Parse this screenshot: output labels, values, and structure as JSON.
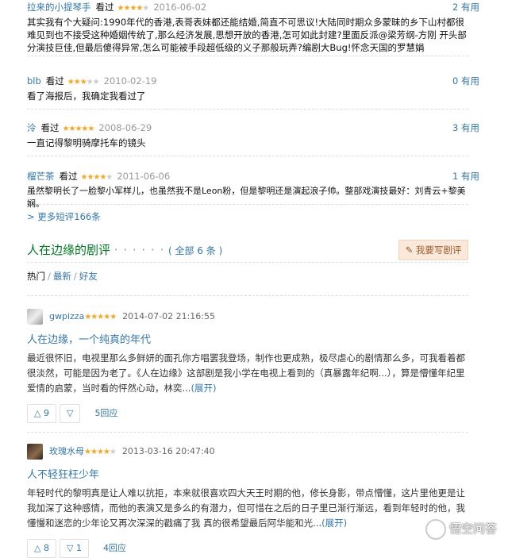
{
  "short_comments": [
    {
      "user": "拉来的小提琴手",
      "watched": "看过",
      "stars": 4,
      "date": "2016-06-02",
      "useful": "2 有用",
      "text": "其实我有个大疑问:1990年代的香港,表哥表妹都还能结婚,简直不可思议!大陆同时期众多蒙昧的乡下山村都很难见到也不接受这种婚姻传统了,那么经济发展,思想开放的香港,怎可如此封建?里面反派@梁芳纲-方刚 开头部分演技巨佳,但最后傻得异常,怎么可能被手段超低级的义子那般玩弄?编剧大Bug!怀念天国的罗慧娟"
    },
    {
      "user": "blb",
      "watched": "看过",
      "stars": 3,
      "date": "2010-02-19",
      "useful": "0 有用",
      "text": "看了海报后，我确定我看过了"
    },
    {
      "user": "泠",
      "watched": "看过",
      "stars": 5,
      "date": "2008-06-29",
      "useful": "3 有用",
      "text": "一直记得黎明骑摩托车的镜头"
    },
    {
      "user": "榴芒茶",
      "watched": "看过",
      "stars": 4,
      "date": "2011-06-06",
      "useful": "1 有用",
      "text": "虽然黎明长了一脸黎小军样儿，也虽然我不是Leon粉，但是黎明还是演起浪子帅。整部戏演技最好：刘青云+黎美娴。"
    }
  ],
  "more_short": "> 更多短评166条",
  "reviews_section": {
    "title": "人在边缘的剧评",
    "dots": "· · · · · ·",
    "all_link": "( 全部 6 条 )",
    "write_button": "我要写剧评",
    "sort": [
      "热门",
      "最新",
      "好友"
    ],
    "sort_sep": "/"
  },
  "reviews": [
    {
      "user": "gwpizza",
      "stars": 5,
      "date": "2014-07-02 21:16:55",
      "title": "人在边缘，一个纯真的年代",
      "text": "最近很怀旧，电视里那么多鲜妍的面孔你方唱罢我登场，制作也更成熟，极尽虐心的剧情那么多，可我看着都很淡然，可能是因为老了。《人在边缘》这部剧是我小学在电视上看到的（真暴露年纪啊...），算是懵懂年纪里爱情的启蒙，当时看的怦然心动，林奕...",
      "expand": "(展开)",
      "votes_up": "9",
      "votes_down": "",
      "replies": "5回应"
    },
    {
      "user": "玫瑰水母",
      "stars": 4,
      "date": "2013-03-16 20:47:40",
      "title": "人不轻狂枉少年",
      "text": "年轻时代的黎明真是让人难以抗拒，本来就很喜欢四大天王时期的他，修长身影，带点懵懂，这片里他更是让我加深了这种感情，而他的表演又是多么的有潜力，但可惜在之后的日子里已渐行渐远，看到年轻时的他，我懂慢和迷恋的少年论又再次深深的戳痛了我 真的很希望最后阿华能和光...",
      "expand": "(展开)",
      "votes_up": "8",
      "votes_down": "1",
      "replies": "4回应"
    }
  ],
  "watermark": "悟空问答",
  "colors": {
    "link": "#3377aa",
    "section_title": "#007722",
    "star": "#f5a623"
  }
}
